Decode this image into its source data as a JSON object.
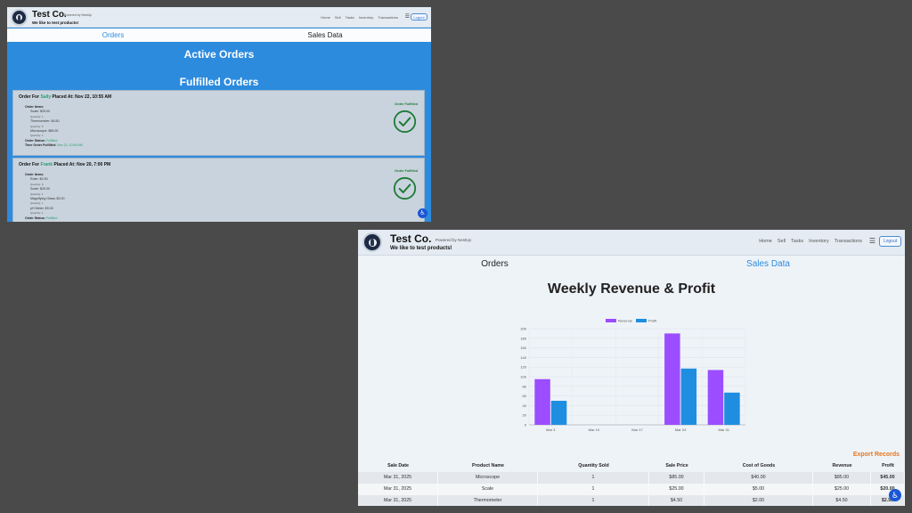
{
  "app": {
    "brand": "Test Co.",
    "powered_by": "Powered by NestUp",
    "tagline": "We like to test products!",
    "nav": [
      "Home",
      "Sell",
      "Tasks",
      "Inventory",
      "Transactions"
    ],
    "menu_icon": "hamburger-icon",
    "logout": "Logout",
    "tabs": [
      "Orders",
      "Sales Data"
    ],
    "accent_color": "#2d8bde",
    "accessibility_icon": "accessibility-icon"
  },
  "orders_view": {
    "active_tab_index": 0,
    "active_heading": "Active Orders",
    "fulfilled_heading": "Fulfilled Orders",
    "cards": [
      {
        "prefix": "Order For",
        "name": "Sally",
        "placed": "Placed At: Nov 22, 10:55 AM",
        "items_label": "Order Items:",
        "items": [
          {
            "label": "Scale: $25.00",
            "qty": "Quantity: 1"
          },
          {
            "label": "Thermometer: $4.50",
            "qty": "Quantity: 5"
          },
          {
            "label": "Microscope: $85.00",
            "qty": "Quantity: 1"
          }
        ],
        "status_label": "Order Status:",
        "status": "Fulfilled",
        "time_label": "Time Order Fulfilled:",
        "time": "Nov 22, 10:55 AM",
        "badge": "Order Fulfilled"
      },
      {
        "prefix": "Order For",
        "name": "Frank",
        "placed": "Placed At: Nov 20, 7:00 PM",
        "items_label": "Order Items:",
        "items": [
          {
            "label": "Ruler: $2.50",
            "qty": "Quantity: 6"
          },
          {
            "label": "Scale: $25.00",
            "qty": "Quantity: 1"
          },
          {
            "label": "Magnifying Glass: $3.00",
            "qty": "Quantity: 1"
          },
          {
            "label": "pH Meter: $9.00",
            "qty": "Quantity: 1"
          }
        ],
        "status_label": "Order Status:",
        "status": "Fulfilled",
        "badge": "Order Fulfilled"
      }
    ]
  },
  "sales_view": {
    "active_tab_index": 1,
    "title": "Weekly Revenue & Profit",
    "export": "Export Records",
    "table": {
      "headers": [
        "Sale Date",
        "Product Name",
        "Quantity Sold",
        "Sale Price",
        "Cost of Goods",
        "Revenue",
        "Profit"
      ],
      "rows": [
        [
          "Mar 31, 2025",
          "Microscope",
          "1",
          "$85.00",
          "$40.00",
          "$85.00",
          "$45.00"
        ],
        [
          "Mar 31, 2025",
          "Scale",
          "1",
          "$25.00",
          "$5.00",
          "$25.00",
          "$20.00"
        ],
        [
          "Mar 31, 2025",
          "Thermometer",
          "1",
          "$4.50",
          "$2.00",
          "$4.50",
          "$2.50"
        ]
      ]
    }
  },
  "chart_data": {
    "type": "bar",
    "categories": [
      "Mar 3",
      "Mar 10",
      "Mar 17",
      "Mar 24",
      "Mar 31"
    ],
    "series": [
      {
        "name": "Revenue",
        "color": "#9b4dff",
        "values": [
          95,
          0,
          0,
          190,
          114
        ]
      },
      {
        "name": "Profit",
        "color": "#1f8ee0",
        "values": [
          50,
          0,
          0,
          117,
          67
        ]
      }
    ],
    "ylim": [
      0,
      200
    ],
    "yticks": [
      0,
      20,
      40,
      60,
      80,
      100,
      120,
      140,
      160,
      180,
      200
    ],
    "legend": "top",
    "grid": true
  }
}
